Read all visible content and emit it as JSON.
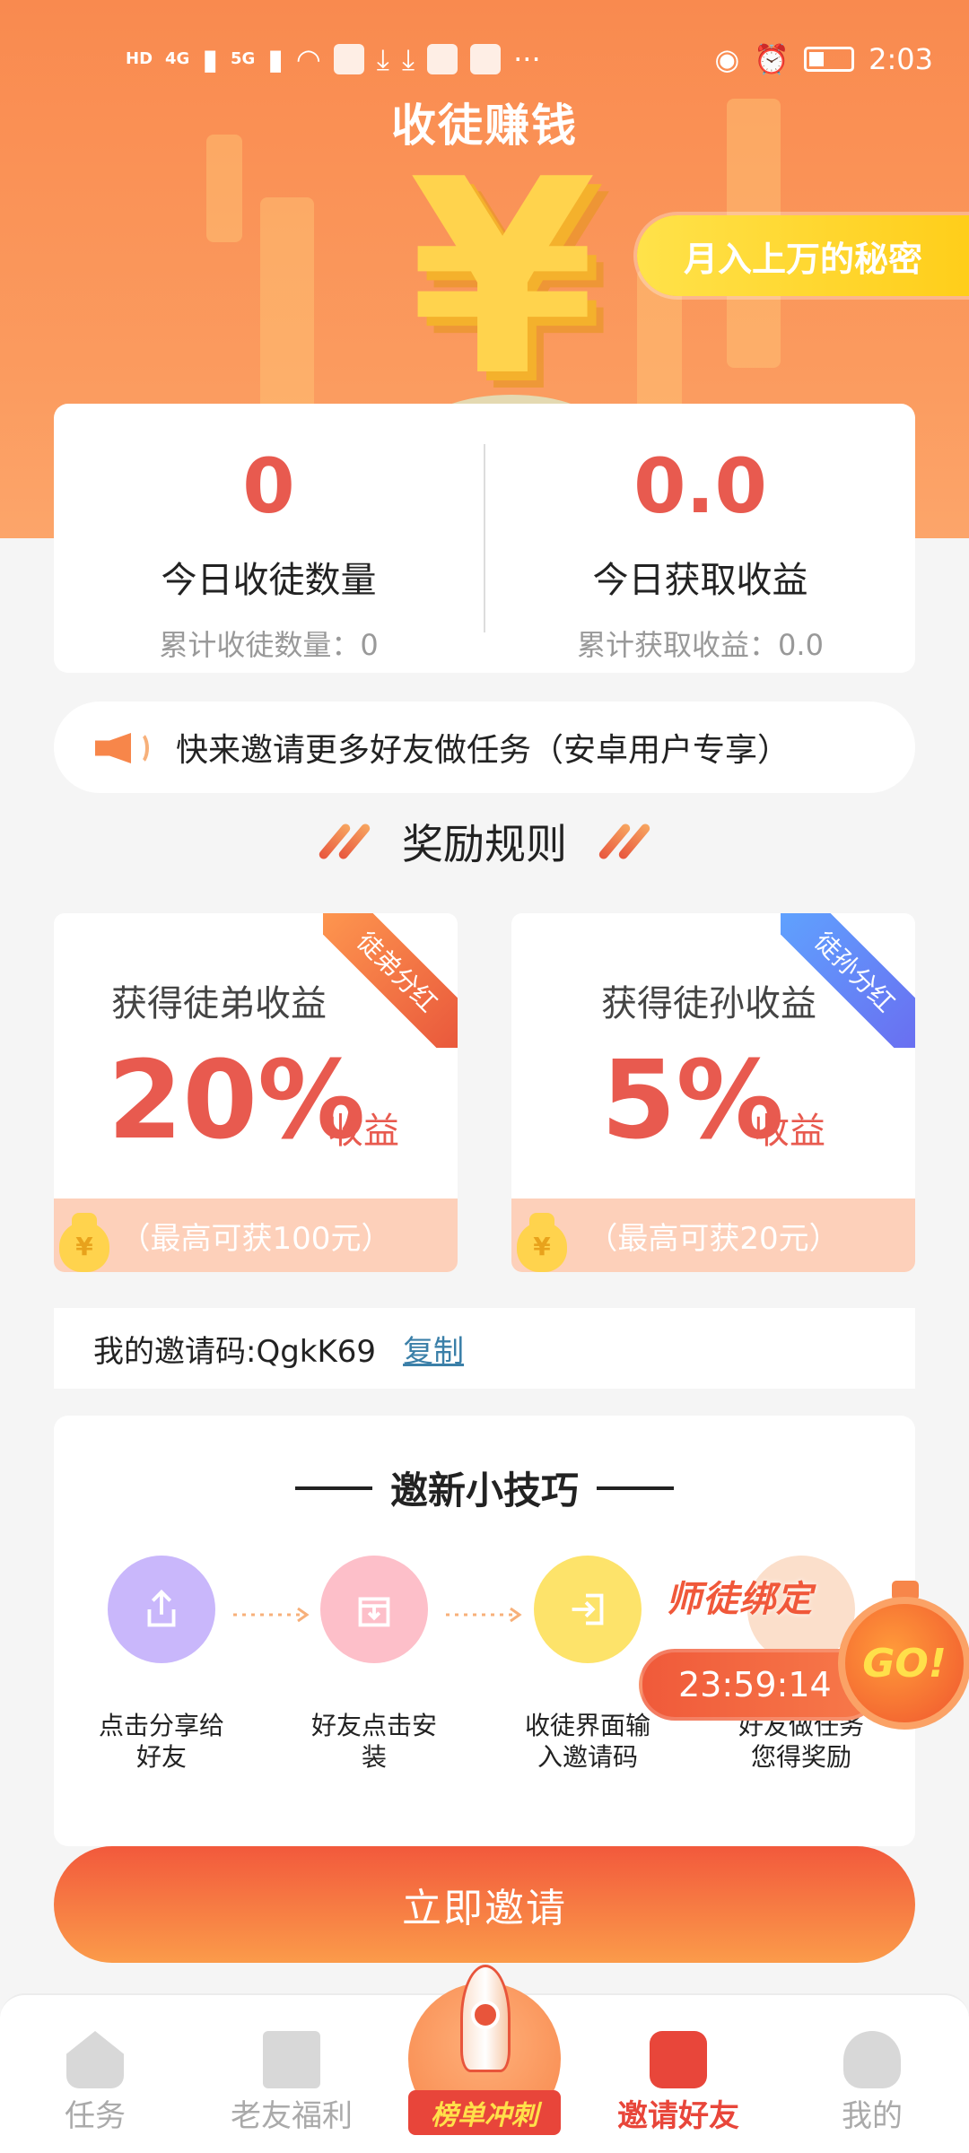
{
  "status_bar": {
    "time": "2:03",
    "network_left": "HD",
    "network_4g": "4G",
    "network_5g": "5G",
    "more": "···"
  },
  "header": {
    "title": "收徒赚钱",
    "secret_button": "月入上万的秘密",
    "yen_symbol": "¥"
  },
  "stats": {
    "today_apprentices_value": "0",
    "today_apprentices_label": "今日收徒数量",
    "total_apprentices": "累计收徒数量：0",
    "today_earnings_value": "0.0",
    "today_earnings_label": "今日获取收益",
    "total_earnings": "累计获取收益：0.0"
  },
  "notice": {
    "text": "快来邀请更多好友做任务（安卓用户专享）"
  },
  "rules": {
    "title": "奖励规则",
    "cards": [
      {
        "ribbon": "徒弟分红",
        "title": "获得徒弟收益",
        "percent": "20%",
        "unit": "收益",
        "footer": "（最高可获100元）"
      },
      {
        "ribbon": "徒孙分红",
        "title": "获得徒孙收益",
        "percent": "5%",
        "unit": "收益",
        "footer": "（最高可获20元）"
      }
    ]
  },
  "invite_code": {
    "text": "我的邀请码:QgkK69",
    "copy_label": "复制"
  },
  "tips": {
    "title": "邀新小技巧",
    "steps": [
      {
        "label_line1": "点击分享给",
        "label_line2": "好友"
      },
      {
        "label_line1": "好友点击安",
        "label_line2": "装"
      },
      {
        "label_line1": "收徒界面输",
        "label_line2": "入邀请码"
      },
      {
        "label_line1": "好友做任务",
        "label_line2": "您得奖励"
      }
    ]
  },
  "floating": {
    "tag": "师徒绑定",
    "timer": "23:59:14",
    "go": "GO!"
  },
  "invite_button": "立即邀请",
  "bottom_nav": {
    "items": [
      {
        "label": "任务"
      },
      {
        "label": "老友福利"
      },
      {
        "label": "榜单冲刺"
      },
      {
        "label": "邀请好友"
      },
      {
        "label": "我的"
      }
    ],
    "active_index": 3
  },
  "colors": {
    "accent_red": "#e85a4f",
    "header_orange": "#f98a4f",
    "secret_yellow": "#ffd21f"
  }
}
